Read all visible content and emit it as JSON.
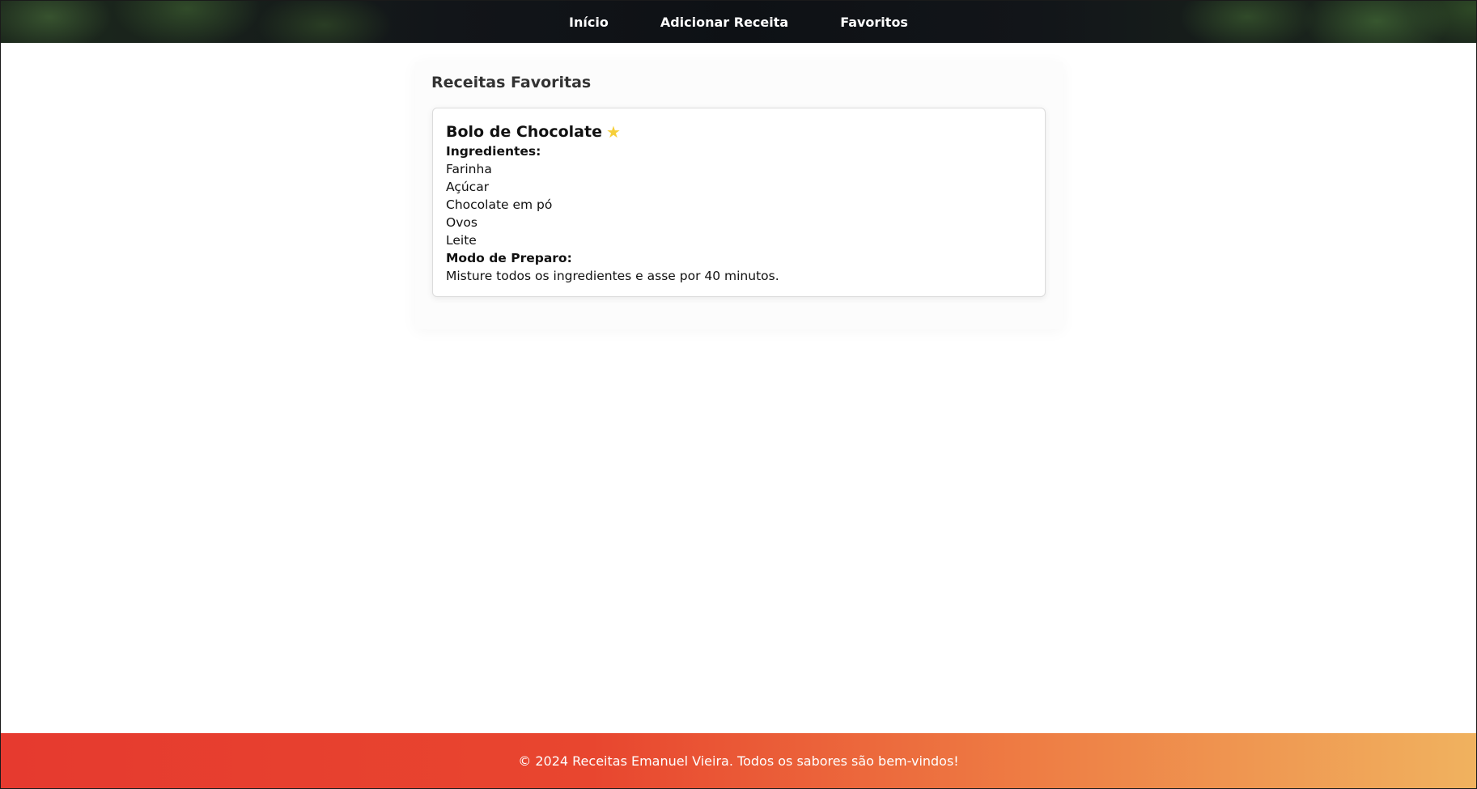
{
  "nav": {
    "items": [
      {
        "label": "Início"
      },
      {
        "label": "Adicionar Receita"
      },
      {
        "label": "Favoritos"
      }
    ]
  },
  "favorites": {
    "title": "Receitas Favoritas",
    "recipe": {
      "name": "Bolo de Chocolate",
      "star_icon": "star-icon",
      "star_glyph": "★",
      "ingredients_label": "Ingredientes:",
      "ingredients": [
        "Farinha",
        "Açúcar",
        "Chocolate em pó",
        "Ovos",
        "Leite"
      ],
      "method_label": "Modo de Preparo:",
      "method": "Misture todos os ingredientes e asse por 40 minutos."
    }
  },
  "footer": {
    "text": "© 2024 Receitas Emanuel Vieira. Todos os sabores são bem-vindos!"
  },
  "colors": {
    "star": "#f6cf3a",
    "footer_start": "#e63a2f",
    "footer_end": "#f0b25f"
  }
}
